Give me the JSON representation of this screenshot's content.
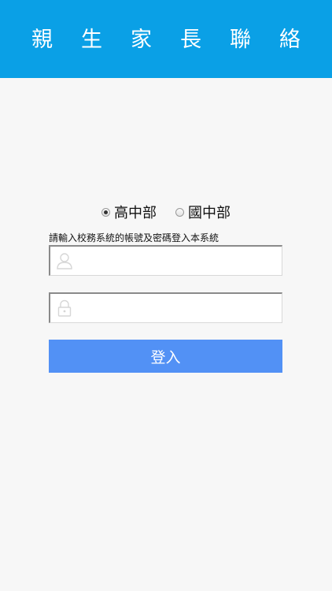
{
  "header": {
    "title": "親生家長聯絡"
  },
  "school_selector": {
    "options": [
      {
        "label": "高中部",
        "selected": true
      },
      {
        "label": "國中部",
        "selected": false
      }
    ]
  },
  "login_form": {
    "hint": "請輸入校務系統的帳號及密碼登入本系統",
    "username": {
      "value": "",
      "placeholder": "",
      "icon": "user-icon"
    },
    "password": {
      "value": "",
      "placeholder": "",
      "icon": "lock-icon"
    },
    "submit_label": "登入"
  },
  "colors": {
    "header_bg": "#0aa0e6",
    "button_bg": "#5291f5",
    "page_bg": "#f7f7f7"
  }
}
